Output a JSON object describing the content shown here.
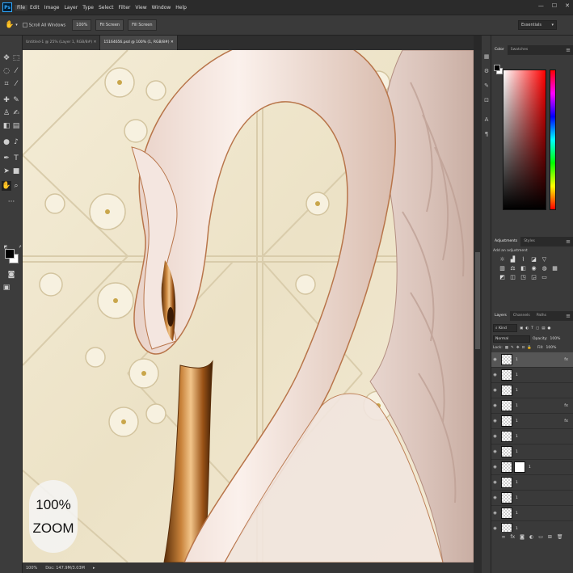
{
  "app": {
    "logo": "Ps"
  },
  "menu": [
    "File",
    "Edit",
    "Image",
    "Layer",
    "Type",
    "Select",
    "Filter",
    "View",
    "Window",
    "Help"
  ],
  "window_controls": [
    "—",
    "☐",
    "✕"
  ],
  "options_bar": {
    "scroll_all_windows": "Scroll All Windows",
    "btn_100": "100%",
    "btn_fit": "Fit Screen",
    "btn_fill": "Fill Screen",
    "workspace": "Essentials"
  },
  "documents": {
    "tab1": "Untitled-1 @ 25% (Layer 1, RGB/8#)",
    "tab2": "15164656.psd @ 100% (1, RGB/8#)"
  },
  "watermark": {
    "line1": "100%",
    "line2": "ZOOM"
  },
  "status": {
    "zoom": "100%",
    "doc": "Doc: 147.9M/3.03M"
  },
  "color_panel": {
    "tab_color": "Color",
    "tab_swatches": "Swatches"
  },
  "adjustments_panel": {
    "tab_adjustments": "Adjustments",
    "tab_styles": "Styles",
    "title": "Add an adjustment"
  },
  "layers_panel": {
    "tab_layers": "Layers",
    "tab_channels": "Channels",
    "tab_paths": "Paths",
    "filter": "Kind",
    "blend_mode": "Normal",
    "opacity_label": "Opacity:",
    "opacity_value": "100%",
    "lock_label": "Lock:",
    "fill_label": "Fill:",
    "fill_value": "100%",
    "layers": [
      {
        "name": "1",
        "fx": "fx"
      },
      {
        "name": "1",
        "fx": ""
      },
      {
        "name": "1",
        "fx": ""
      },
      {
        "name": "1",
        "fx": "fx"
      },
      {
        "name": "1",
        "fx": "fx"
      },
      {
        "name": "1",
        "fx": ""
      },
      {
        "name": "1",
        "fx": ""
      },
      {
        "name": "1",
        "fx": ""
      },
      {
        "name": "1",
        "fx": ""
      },
      {
        "name": "1",
        "fx": ""
      },
      {
        "name": "1",
        "fx": ""
      },
      {
        "name": "1",
        "fx": ""
      }
    ]
  }
}
